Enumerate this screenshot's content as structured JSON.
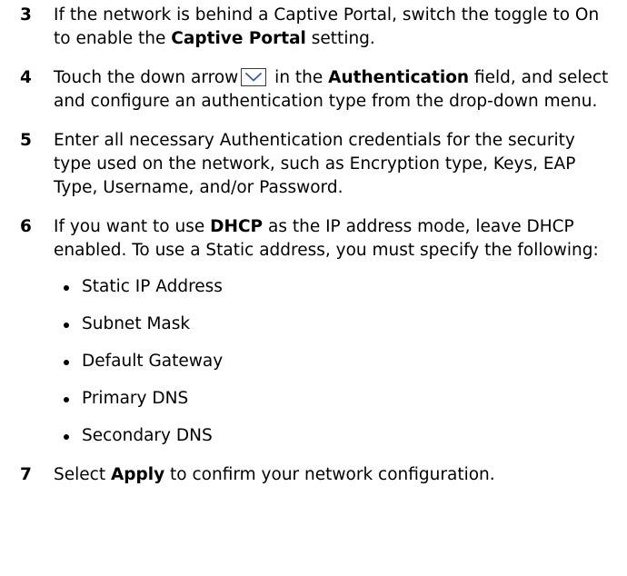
{
  "steps": [
    {
      "number": "3",
      "parts": [
        {
          "text": "If the network is behind a Captive Portal, switch the toggle to On to enable the ",
          "bold": false
        },
        {
          "text": "Captive Portal",
          "bold": true
        },
        {
          "text": " setting.",
          "bold": false
        }
      ]
    },
    {
      "number": "4",
      "parts_before_icon": [
        {
          "text": "Touch the down arrow",
          "bold": false
        }
      ],
      "icon": "chevron-down-icon",
      "parts_after_icon": [
        {
          "text": " in the ",
          "bold": false
        },
        {
          "text": "Authentication",
          "bold": true
        },
        {
          "text": " field, and select and configure an authentication type from the drop-down menu.",
          "bold": false
        }
      ]
    },
    {
      "number": "5",
      "parts": [
        {
          "text": "Enter all necessary Authentication credentials for the security type used on the network, such as Encryption type, Keys, EAP Type, Username, and/or Password.",
          "bold": false
        }
      ]
    },
    {
      "number": "6",
      "parts": [
        {
          "text": "If you want to use ",
          "bold": false
        },
        {
          "text": "DHCP",
          "bold": true
        },
        {
          "text": " as the IP address mode, leave DHCP enabled. To use a Static address, you must specify the following:",
          "bold": false
        }
      ],
      "bullets": [
        "Static IP Address",
        "Subnet Mask",
        "Default Gateway",
        "Primary DNS",
        "Secondary DNS"
      ]
    },
    {
      "number": "7",
      "parts": [
        {
          "text": "Select ",
          "bold": false
        },
        {
          "text": "Apply",
          "bold": true
        },
        {
          "text": " to confirm your network configuration.",
          "bold": false
        }
      ]
    }
  ]
}
